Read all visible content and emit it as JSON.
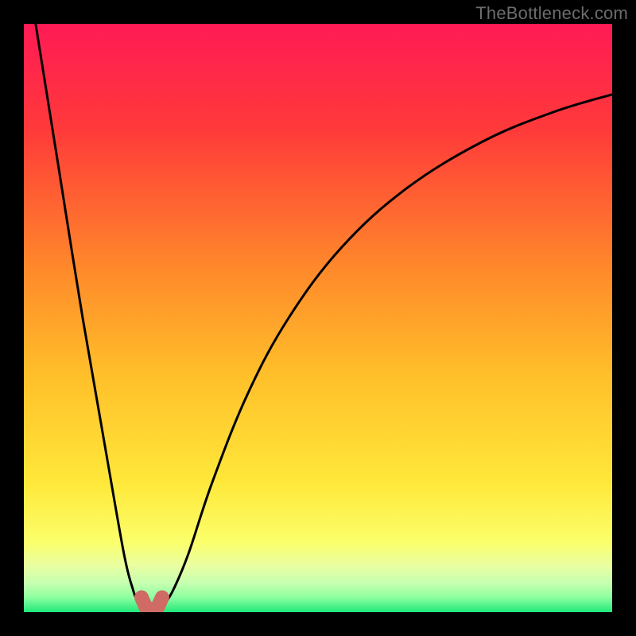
{
  "watermark": "TheBottleneck.com",
  "chart_data": {
    "type": "line",
    "title": "",
    "xlabel": "",
    "ylabel": "",
    "xlim": [
      0,
      100
    ],
    "ylim": [
      0,
      100
    ],
    "grid": false,
    "legend": false,
    "series": [
      {
        "name": "left-branch",
        "color": "#000000",
        "x": [
          2,
          6,
          10,
          14,
          17,
          18.5,
          19.5,
          20.5
        ],
        "y": [
          100,
          75,
          50,
          27,
          10,
          4,
          1.5,
          0.5
        ]
      },
      {
        "name": "right-branch",
        "color": "#000000",
        "x": [
          23,
          24,
          25.5,
          28,
          32,
          38,
          45,
          54,
          65,
          78,
          90,
          100
        ],
        "y": [
          0.5,
          1.5,
          4,
          10,
          22,
          37,
          50,
          62,
          72,
          80,
          85,
          88
        ]
      },
      {
        "name": "minimum-marker",
        "color": "#cf6a65",
        "x": [
          20,
          20.7,
          21.4,
          22.1,
          22.8,
          23.5
        ],
        "y": [
          2.5,
          0.9,
          0.5,
          0.5,
          0.9,
          2.5
        ]
      }
    ],
    "gradient_stops": [
      {
        "offset": 0.0,
        "color": "#ff1a55"
      },
      {
        "offset": 0.18,
        "color": "#ff3a3a"
      },
      {
        "offset": 0.42,
        "color": "#ff8a2a"
      },
      {
        "offset": 0.6,
        "color": "#ffc02a"
      },
      {
        "offset": 0.78,
        "color": "#ffe83a"
      },
      {
        "offset": 0.88,
        "color": "#fbff6a"
      },
      {
        "offset": 0.92,
        "color": "#eaffa0"
      },
      {
        "offset": 0.95,
        "color": "#c7ffb0"
      },
      {
        "offset": 0.975,
        "color": "#8effa0"
      },
      {
        "offset": 1.0,
        "color": "#20e87a"
      }
    ]
  }
}
